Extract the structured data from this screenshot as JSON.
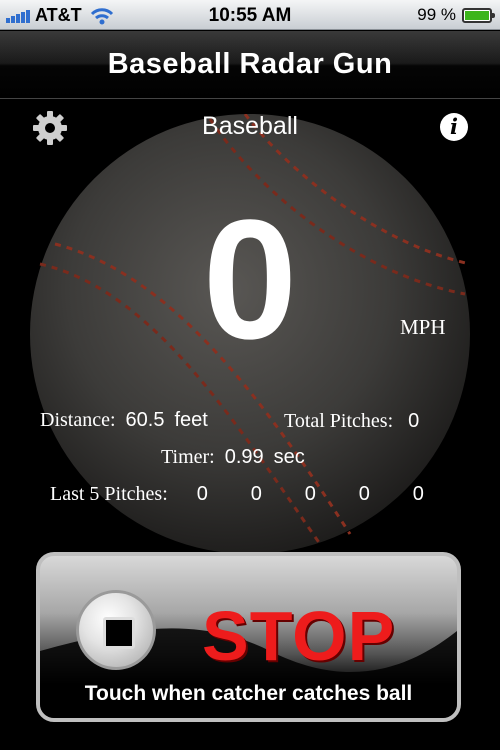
{
  "status_bar": {
    "carrier": "AT&T",
    "time": "10:55 AM",
    "battery": "99 %",
    "battery_level": 0.99
  },
  "header": {
    "title": "Baseball Radar Gun"
  },
  "main": {
    "sport": "Baseball",
    "speed": "0",
    "unit": "MPH",
    "distance_label": "Distance:",
    "distance_value": "60.5",
    "distance_unit": "feet",
    "total_pitches_label": "Total Pitches:",
    "total_pitches_value": "0",
    "timer_label": "Timer:",
    "timer_value": "0.99",
    "timer_unit": "sec",
    "last_pitches_label": "Last 5 Pitches:",
    "last_pitches": [
      "0",
      "0",
      "0",
      "0",
      "0"
    ]
  },
  "stop_button": {
    "label": "STOP",
    "hint": "Touch when catcher catches ball"
  },
  "icons": {
    "settings": "gear-icon",
    "info": "info-icon",
    "stop": "stop-icon",
    "wifi": "wifi-icon",
    "signal": "signal-icon",
    "battery": "battery-icon"
  },
  "colors": {
    "stop_text": "#ee1c1c",
    "battery_fill": "#3cb51b",
    "signal": "#2f6ecf"
  }
}
